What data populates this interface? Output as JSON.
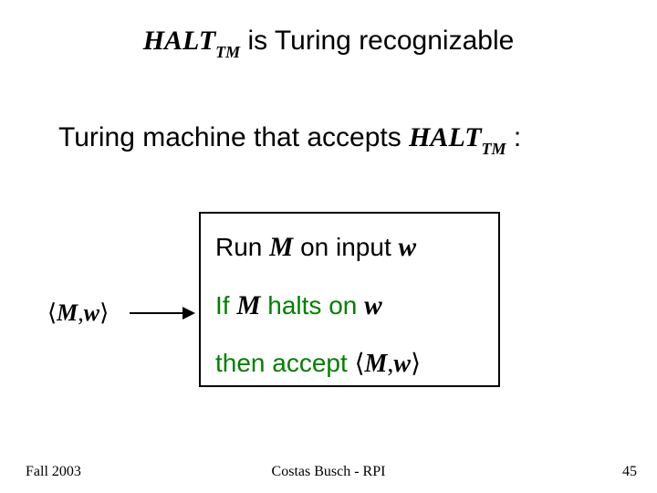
{
  "title": {
    "halt_main": "HALT",
    "halt_sub": "TM",
    "rest": " is Turing recognizable"
  },
  "subtitle": {
    "text": "Turing machine that accepts ",
    "halt_main": "HALT",
    "halt_sub": "TM",
    "colon": " :"
  },
  "tuple": {
    "open": "⟨",
    "m": "M",
    "comma": ",",
    "w": "w",
    "close": "⟩"
  },
  "algo": {
    "line1": {
      "run": "Run  ",
      "m": "M",
      "on_input": "  on input  ",
      "w": "w"
    },
    "line2": {
      "if": "If  ",
      "m": "M",
      "halts_on": "  halts on  ",
      "w": "w"
    },
    "line3": {
      "then_accept": "then accept  ",
      "open": "⟨",
      "m": "M",
      "comma": ",",
      "w2": "w",
      "close": "⟩"
    }
  },
  "footer": {
    "left": "Fall 2003",
    "center": "Costas Busch - RPI",
    "right": "45"
  }
}
